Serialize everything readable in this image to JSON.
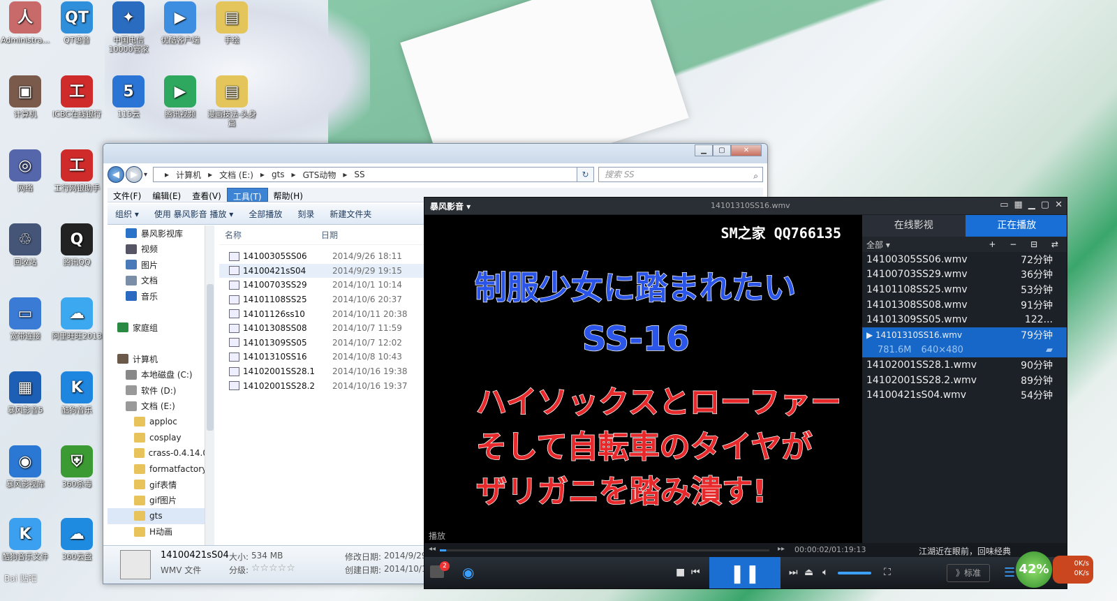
{
  "desktop": {
    "icons": [
      {
        "label": "Administra...",
        "color": "#c86a6a",
        "glyph": "人"
      },
      {
        "label": "QT语音",
        "color": "#2f8fdb",
        "glyph": "QT"
      },
      {
        "label": "中国电信10000管家",
        "color": "#2a6cc0",
        "glyph": "✦"
      },
      {
        "label": "优酷客户端",
        "color": "#3d8ee0",
        "glyph": "▶"
      },
      {
        "label": "手绘",
        "color": "#e4c55c",
        "glyph": "▤"
      },
      {
        "label": "计算机",
        "color": "#7a5a4a",
        "glyph": "▣"
      },
      {
        "label": "ICBC在线银行",
        "color": "#d02b2b",
        "glyph": "工"
      },
      {
        "label": "115云",
        "color": "#2a74d6",
        "glyph": "5"
      },
      {
        "label": "腾讯视频",
        "color": "#2da85e",
        "glyph": "▶"
      },
      {
        "label": "漫画技法-头身篇",
        "color": "#e4c55c",
        "glyph": "▤"
      },
      {
        "label": "网络",
        "color": "#5566aa",
        "glyph": "◎"
      },
      {
        "label": "工行网银助手",
        "color": "#d02b2b",
        "glyph": "工"
      },
      {
        "label": "回收站",
        "color": "#445577",
        "glyph": "♲"
      },
      {
        "label": "腾讯QQ",
        "color": "#222222",
        "glyph": "Q"
      },
      {
        "label": "宽带连接",
        "color": "#3a7bd5",
        "glyph": "▭"
      },
      {
        "label": "阿里旺旺2013",
        "color": "#3ba8f0",
        "glyph": "☁"
      },
      {
        "label": "暴风影音5",
        "color": "#1d5fb4",
        "glyph": "▦"
      },
      {
        "label": "酷狗音乐",
        "color": "#1f86e0",
        "glyph": "K"
      },
      {
        "label": "暴风影视库",
        "color": "#2a78d4",
        "glyph": "◉"
      },
      {
        "label": "360杀毒",
        "color": "#3c9a32",
        "glyph": "⛨"
      },
      {
        "label": "酷狗音乐文件",
        "color": "#3ba0f0",
        "glyph": "K"
      },
      {
        "label": "360云盘",
        "color": "#1f8be0",
        "glyph": "☁"
      }
    ]
  },
  "explorer": {
    "window_buttons": {
      "min": "▁",
      "max": "▢",
      "close": "✕"
    },
    "nav": {
      "back": "◀",
      "forward": "▶",
      "dropdown": "▾"
    },
    "address": [
      "计算机",
      "文档 (E:)",
      "gts",
      "GTS动物",
      "SS"
    ],
    "address_sep": "▸",
    "refresh_icon": "↻",
    "search_placeholder": "搜索 SS",
    "search_icon": "⌕",
    "menu": [
      "文件(F)",
      "编辑(E)",
      "查看(V)",
      "工具(T)",
      "帮助(H)"
    ],
    "toolbar": [
      "组织 ▾",
      "使用 暴风影音 播放 ▾",
      "全部播放",
      "刻录",
      "新建文件夹"
    ],
    "nav_items": [
      {
        "label": "暴风影视库",
        "color": "#2b72c9",
        "indent": 1
      },
      {
        "label": "视频",
        "color": "#556",
        "indent": 1
      },
      {
        "label": "图片",
        "color": "#4a7ab8",
        "indent": 1
      },
      {
        "label": "文档",
        "color": "#7a8ea8",
        "indent": 1
      },
      {
        "label": "音乐",
        "color": "#2a6ac0",
        "indent": 1
      },
      {
        "label": "",
        "color": "transparent",
        "indent": 0
      },
      {
        "label": "家庭组",
        "color": "#2a8a44",
        "indent": 0
      },
      {
        "label": "",
        "color": "transparent",
        "indent": 0
      },
      {
        "label": "计算机",
        "color": "#6b5a4a",
        "indent": 0
      },
      {
        "label": "本地磁盘 (C:)",
        "color": "#888",
        "indent": 1
      },
      {
        "label": "软件 (D:)",
        "color": "#999",
        "indent": 1
      },
      {
        "label": "文档 (E:)",
        "color": "#999",
        "indent": 1
      },
      {
        "label": "apploc",
        "color": "#e8c25a",
        "indent": 2
      },
      {
        "label": "cosplay",
        "color": "#e8c25a",
        "indent": 2
      },
      {
        "label": "crass-0.4.14.0",
        "color": "#e8c25a",
        "indent": 2
      },
      {
        "label": "formatfactory",
        "color": "#e8c25a",
        "indent": 2
      },
      {
        "label": "gif表情",
        "color": "#e8c25a",
        "indent": 2
      },
      {
        "label": "gif图片",
        "color": "#e8c25a",
        "indent": 2
      },
      {
        "label": "gts",
        "color": "#e8c25a",
        "indent": 2,
        "selected": true
      },
      {
        "label": "H动画",
        "color": "#e8c25a",
        "indent": 2
      }
    ],
    "columns": {
      "name": "名称",
      "date": "日期"
    },
    "files": [
      {
        "name": "14100305SS06",
        "date": "2014/9/26 18:11"
      },
      {
        "name": "14100421sS04",
        "date": "2014/9/29 19:15",
        "selected": true
      },
      {
        "name": "14100703SS29",
        "date": "2014/10/1 10:14"
      },
      {
        "name": "14101108SS25",
        "date": "2014/10/6 20:37"
      },
      {
        "name": "14101126ss10",
        "date": "2014/10/11 20:38"
      },
      {
        "name": "14101308SS08",
        "date": "2014/10/7 11:59"
      },
      {
        "name": "14101309SS05",
        "date": "2014/10/7 12:02"
      },
      {
        "name": "14101310SS16",
        "date": "2014/10/8 10:43"
      },
      {
        "name": "14102001SS28.1",
        "date": "2014/10/16 19:38"
      },
      {
        "name": "14102001SS28.2",
        "date": "2014/10/16 19:37"
      }
    ],
    "details": {
      "name": "14100421sS04",
      "type": "WMV 文件",
      "size_label": "大小:",
      "size": "534 MB",
      "rating_label": "分级:",
      "stars": "☆☆☆☆☆",
      "mod_label": "修改日期:",
      "mod": "2014/9/29",
      "created_label": "创建日期:",
      "created": "2014/10/1"
    }
  },
  "player": {
    "logo": "暴风影音 ▾",
    "filename": "14101310SS16.wmv",
    "title_ctrls": [
      "▭",
      "▦",
      "▁",
      "▢",
      "✕"
    ],
    "video": {
      "watermark": "SM之家 QQ766135",
      "line1": "制服少女に踏まれたい",
      "line2": "SS-16",
      "line3": "ハイソックスとローファー",
      "line4": "そして自転車のタイヤが",
      "line5": "ザリガニを踏み潰す!",
      "state": "播放"
    },
    "tabs": [
      "在线影视",
      "正在播放"
    ],
    "filter": "全部 ▾",
    "list_tools": "+ − ⊟ ⇄",
    "playlist": [
      {
        "name": "14100305SS06.wmv",
        "dur": "72分钟"
      },
      {
        "name": "14100703SS29.wmv",
        "dur": "36分钟"
      },
      {
        "name": "14101108SS25.wmv",
        "dur": "53分钟"
      },
      {
        "name": "14101308SS08.wmv",
        "dur": "91分钟"
      },
      {
        "name": "14101309SS05.wmv",
        "dur": "122..."
      },
      {
        "name": "▶ 14101310SS16.wmv",
        "dur": "79分钟",
        "current": true
      },
      {
        "name": "14102001SS28.1.wmv",
        "dur": "90分钟"
      },
      {
        "name": "14102001SS28.2.wmv",
        "dur": "89分钟"
      },
      {
        "name": "14100421sS04.wmv",
        "dur": "54分钟"
      }
    ],
    "current_info": {
      "size": "781.6M",
      "res": "640×480"
    },
    "time": "00:00:02/01:19:13",
    "progress": 0.0004,
    "slogan": "江湖近在眼前，回味经典",
    "standard": "》标准",
    "net_percent": "42%",
    "net_up": "0K/s",
    "net_down": "0K/s",
    "badge": "2",
    "watermark_baidu": "Bai 贴吧"
  }
}
